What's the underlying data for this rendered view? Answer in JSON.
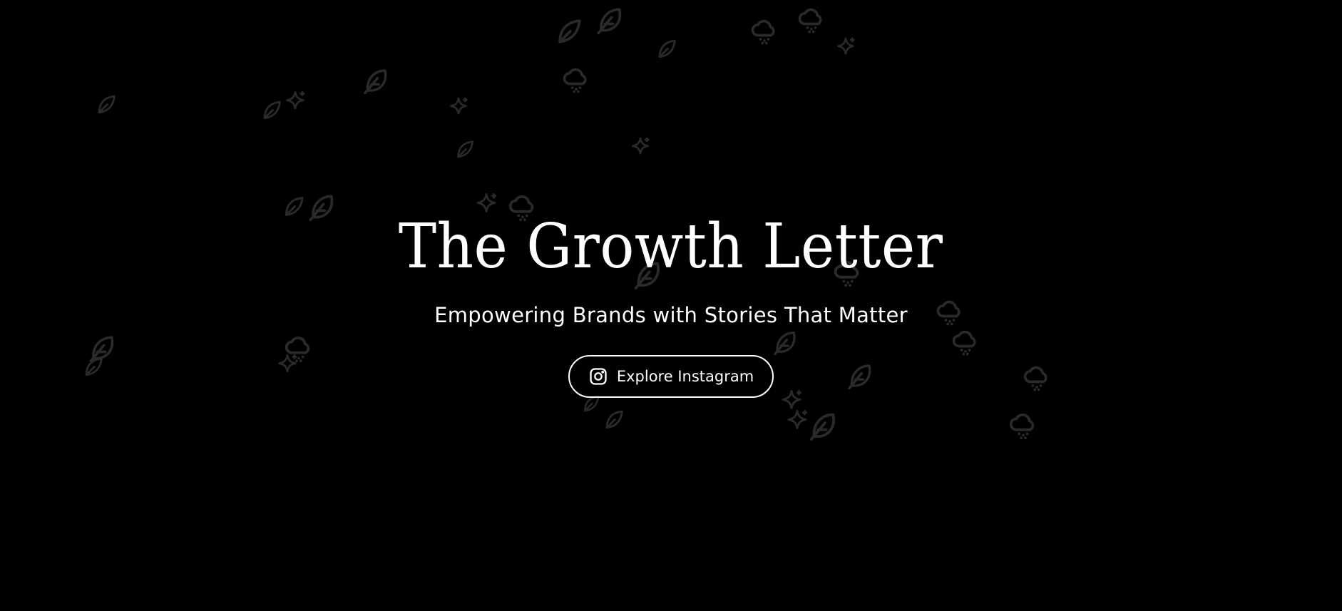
{
  "hero": {
    "title": "The Growth Letter",
    "subtitle": "Empowering Brands with Stories That Matter"
  },
  "cta": {
    "label": "Explore Instagram",
    "icon": "instagram-icon"
  },
  "background": {
    "icons": [
      "leaf-icon",
      "feather-icon",
      "sparkle-icon",
      "snow-cloud-icon"
    ],
    "color": "#000000",
    "icon_color": "#2a2a2a"
  },
  "colors": {
    "text": "#ffffff",
    "background": "#000000"
  }
}
